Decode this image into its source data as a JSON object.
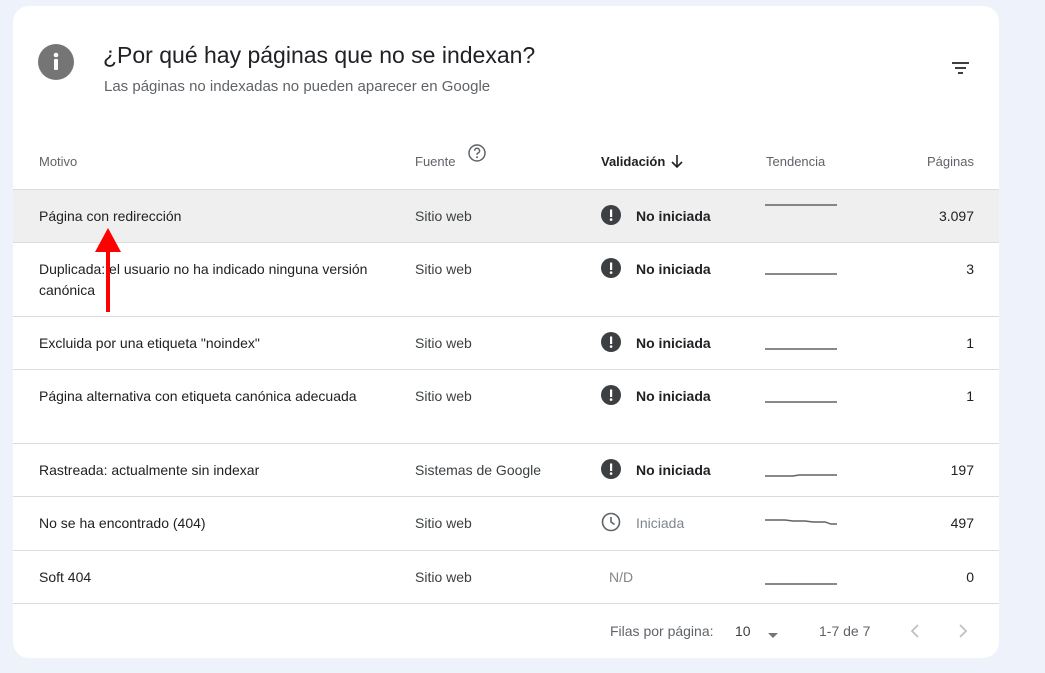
{
  "header": {
    "title": "¿Por qué hay páginas que no se indexan?",
    "subtitle": "Las páginas no indexadas no pueden aparecer en Google",
    "info_icon": "info-icon",
    "filter_icon": "filter-icon"
  },
  "columns": {
    "motivo": "Motivo",
    "fuente": "Fuente",
    "validacion": "Validación",
    "tendencia": "Tendencia",
    "paginas": "Páginas"
  },
  "rows": [
    {
      "motivo": "Página con redirección",
      "fuente": "Sitio web",
      "validacion": "No iniciada",
      "status": "not-started",
      "paginas": "3.097"
    },
    {
      "motivo": "Duplicada: el usuario no ha indicado ninguna versión canónica",
      "fuente": "Sitio web",
      "validacion": "No iniciada",
      "status": "not-started",
      "paginas": "3"
    },
    {
      "motivo": "Excluida por una etiqueta \"noindex\"",
      "fuente": "Sitio web",
      "validacion": "No iniciada",
      "status": "not-started",
      "paginas": "1"
    },
    {
      "motivo": "Página alternativa con etiqueta canónica adecuada",
      "fuente": "Sitio web",
      "validacion": "No iniciada",
      "status": "not-started",
      "paginas": "1"
    },
    {
      "motivo": "Rastreada: actualmente sin indexar",
      "fuente": "Sistemas de Google",
      "validacion": "No iniciada",
      "status": "not-started",
      "paginas": "197"
    },
    {
      "motivo": "No se ha encontrado (404)",
      "fuente": "Sitio web",
      "validacion": "Iniciada",
      "status": "started",
      "paginas": "497"
    },
    {
      "motivo": "Soft 404",
      "fuente": "Sitio web",
      "validacion": "N/D",
      "status": "na",
      "paginas": "0"
    }
  ],
  "footer": {
    "rows_per_page_label": "Filas por página:",
    "rows_per_page_value": "10",
    "range": "1-7 de 7"
  },
  "colors": {
    "accent": "#5f6368",
    "annotation_arrow": "#ff0000"
  }
}
